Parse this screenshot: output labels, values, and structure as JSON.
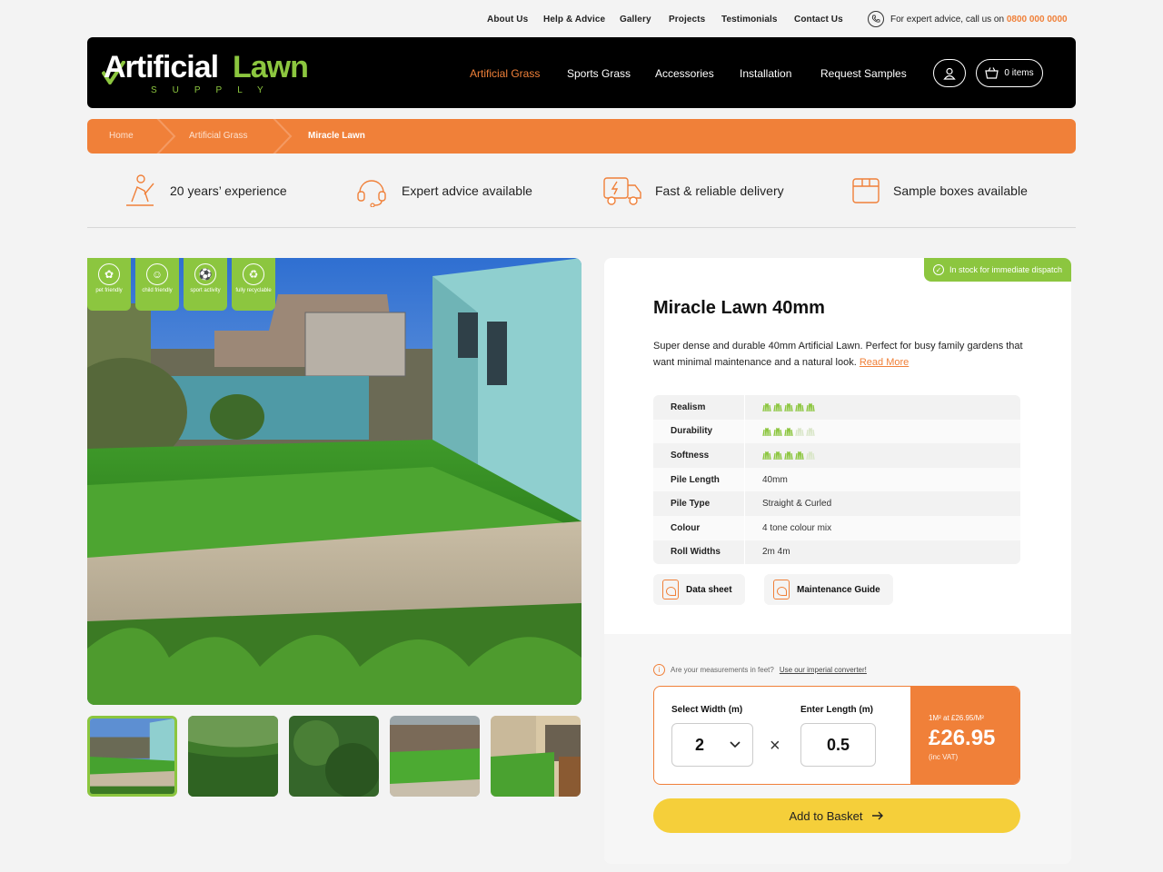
{
  "utility_nav": {
    "links": [
      "About Us",
      "Help & Advice",
      "Gallery",
      "Projects",
      "Testimonials",
      "Contact Us"
    ],
    "call_text": "For expert advice, call us on",
    "phone": "0800 000 0000"
  },
  "header": {
    "logo_word1": "Artificial",
    "logo_word2": "Lawn",
    "logo_sub": "SUPPLY",
    "nav": [
      "Artificial Grass",
      "Sports Grass",
      "Accessories",
      "Installation",
      "Request Samples"
    ],
    "cart_label": "0 items",
    "icons": [
      "user-icon",
      "basket-icon"
    ]
  },
  "breadcrumb": [
    "Home",
    "Artificial Grass",
    "Miracle Lawn"
  ],
  "features": [
    {
      "icon": "worker-icon",
      "label": "20 years’ experience"
    },
    {
      "icon": "headset-icon",
      "label": "Expert advice available"
    },
    {
      "icon": "delivery-van-icon",
      "label": "Fast & reliable delivery"
    },
    {
      "icon": "box-icon",
      "label": "Sample boxes available"
    }
  ],
  "badges": [
    {
      "icon": "paw-icon",
      "label": "pet friendly"
    },
    {
      "icon": "family-icon",
      "label": "child friendly"
    },
    {
      "icon": "football-icon",
      "label": "sport activity"
    },
    {
      "icon": "recycle-icon",
      "label": "fully recyclable"
    }
  ],
  "product": {
    "stock": "In stock for immediate dispatch",
    "title": "Miracle Lawn 40mm",
    "description": "Super dense and durable 40mm Artificial Lawn. Perfect for busy family gardens that want minimal maintenance and a natural look.",
    "read_more": "Read More",
    "ratings": [
      {
        "label": "Realism",
        "score": 5,
        "max": 5
      },
      {
        "label": "Durability",
        "score": 3,
        "max": 5
      },
      {
        "label": "Softness",
        "score": 4,
        "max": 5
      }
    ],
    "specs": [
      {
        "label": "Pile Length",
        "value": "40mm"
      },
      {
        "label": "Pile Type",
        "value": "Straight & Curled"
      },
      {
        "label": "Colour",
        "value": "4 tone colour mix"
      },
      {
        "label": "Roll Widths",
        "value": "2m 4m"
      }
    ],
    "downloads": [
      "Data sheet",
      "Maintenance Guide"
    ]
  },
  "calculator": {
    "converter_text": "Are your measurements in feet?",
    "converter_link": "Use our imperial converter!",
    "width_label": "Select Width (m)",
    "width_value": "2",
    "length_label": "Enter Length (m)",
    "length_value": "0.5",
    "price_sub": "1M² at £26.95/M²",
    "price": "£26.95",
    "vat": "(inc VAT)",
    "add_label": "Add to Basket"
  },
  "colors": {
    "orange": "#f08039",
    "green": "#8cc63f",
    "yellow": "#f5cf3a"
  }
}
